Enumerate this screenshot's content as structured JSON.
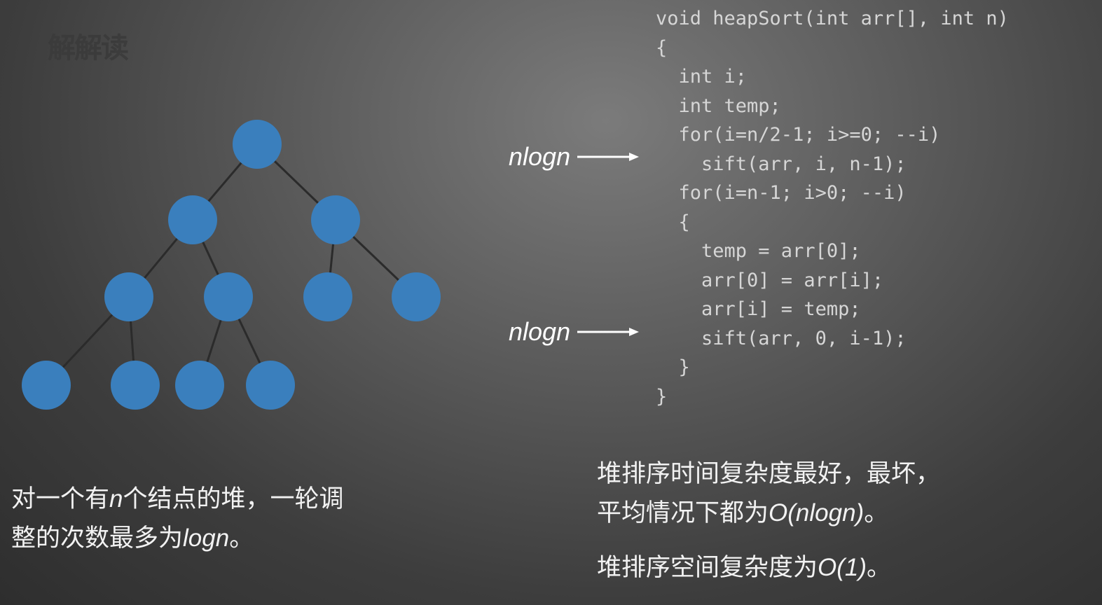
{
  "watermark": "解解读",
  "code": {
    "lines": [
      "void heapSort(int arr[], int n)",
      "{",
      "  int i;",
      "  int temp;",
      "  for(i=n/2-1; i>=0; --i)",
      "    sift(arr, i, n-1);",
      "  for(i=n-1; i>0; --i)",
      "  {",
      "    temp = arr[0];",
      "    arr[0] = arr[i];",
      "    arr[i] = temp;",
      "    sift(arr, 0, i-1);",
      "  }",
      "}"
    ]
  },
  "annotations": [
    {
      "text": "nlogn",
      "icon": "right-arrow"
    },
    {
      "text": "nlogn",
      "icon": "right-arrow"
    }
  ],
  "tree": {
    "node_color": "#3a7fbd",
    "edge_color": "#2b2b2b",
    "nodes": [
      {
        "id": "r"
      },
      {
        "id": "a",
        "parent": "r"
      },
      {
        "id": "b",
        "parent": "r"
      },
      {
        "id": "c",
        "parent": "a"
      },
      {
        "id": "d",
        "parent": "a"
      },
      {
        "id": "e",
        "parent": "b"
      },
      {
        "id": "f",
        "parent": "b"
      },
      {
        "id": "g",
        "parent": "c"
      },
      {
        "id": "h",
        "parent": "c"
      },
      {
        "id": "i",
        "parent": "d"
      },
      {
        "id": "j",
        "parent": "d"
      }
    ]
  },
  "left_note": {
    "line1_a": "对一个有",
    "line1_var": "n",
    "line1_b": "个结点的堆，一轮调",
    "line2_a": "整的次数最多为",
    "line2_var": "logn",
    "line2_b": "。"
  },
  "right_note": {
    "line1": "堆排序时间复杂度最好，最坏，",
    "line2_a": "平均情况下都为",
    "line2_expr": "O(nlogn)",
    "line2_b": "。",
    "line3_a": "堆排序空间复杂度为",
    "line3_expr": "O(1)",
    "line3_b": "。"
  }
}
